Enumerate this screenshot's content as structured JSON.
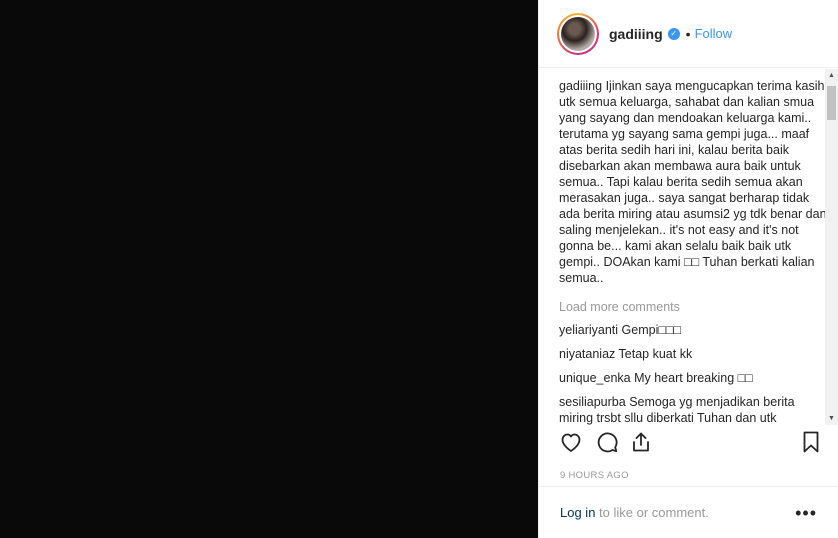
{
  "post": {
    "username": "gadiiing",
    "follow_label": "Follow",
    "separator": "•",
    "caption_user": "gadiiing",
    "caption_text": "Ijinkan saya mengucapkan terima kasih utk semua keluarga, sahabat dan kalian smua yang sayang dan mendoakan keluarga kami.. terutama yg sayang sama gempi juga... maaf atas berita sedih hari ini, kalau berita baik disebarkan akan membawa aura baik untuk semua.. Tapi kalau berita sedih semua akan merasakan juga.. saya sangat berharap tidak ada berita miring atau asumsi2 yg tdk benar dan saling menjelekan.. it's not easy and it's not gonna be... kami akan selalu baik baik utk gempi.. DOAkan kami □□ Tuhan berkati kalian semua..",
    "load_more_label": "Load more comments",
    "comments": [
      {
        "user": "yeliariyanti",
        "text": "Gempi□□□"
      },
      {
        "user": "niyataniaz",
        "text": "Tetap kuat kk"
      },
      {
        "user": "unique_enka",
        "text": "My heart breaking □□"
      },
      {
        "user": "sesiliapurba",
        "text": "Semoga yg menjadikan berita miring trsbt sllu diberkati Tuhan dan utk"
      }
    ],
    "timestamp": "9 HOURS AGO"
  },
  "footer": {
    "login_label": "Log in",
    "login_suffix": " to like or comment.",
    "more_label": "•••"
  },
  "icons": {
    "like": "heart-icon",
    "comment": "comment-icon",
    "share": "share-icon",
    "save": "bookmark-icon",
    "verified": "verified-badge-icon"
  },
  "colors": {
    "link_blue": "#3897f0",
    "login_link": "#003569",
    "muted_text": "#999999",
    "media_bg": "#090909"
  }
}
